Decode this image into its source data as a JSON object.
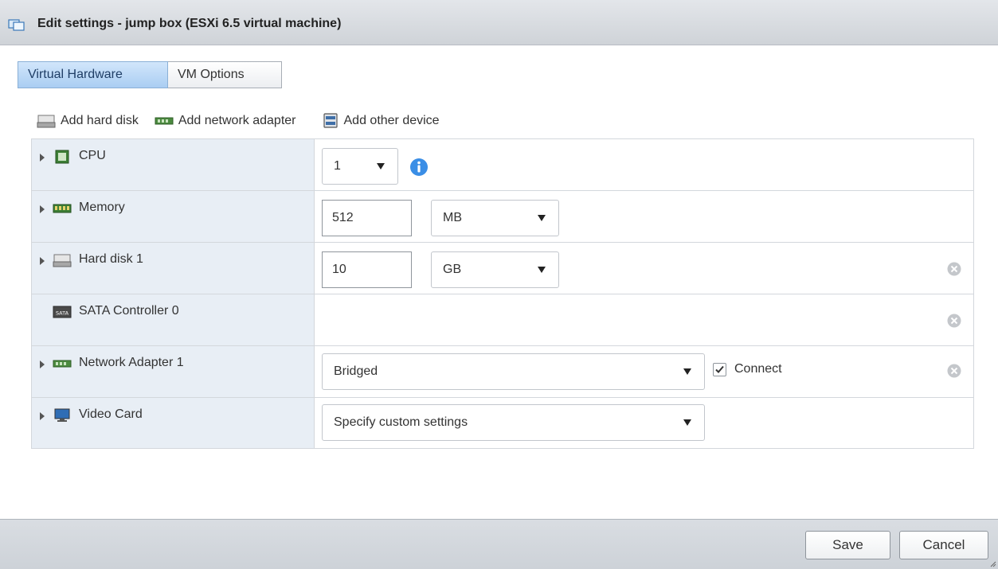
{
  "window": {
    "title": "Edit settings - jump box (ESXi 6.5 virtual machine)",
    "icon": "vm-icon"
  },
  "tabs": [
    {
      "label": "Virtual Hardware",
      "active": true
    },
    {
      "label": "VM Options",
      "active": false
    }
  ],
  "toolbar": {
    "add_hard_disk": "Add hard disk",
    "add_network_adapter": "Add network adapter",
    "add_other_device": "Add other device"
  },
  "devices": {
    "cpu": {
      "label": "CPU",
      "icon": "cpu-icon",
      "value": "1"
    },
    "memory": {
      "label": "Memory",
      "icon": "memory-icon",
      "value": "512",
      "unit": "MB"
    },
    "hard_disk": {
      "label": "Hard disk 1",
      "icon": "hard-disk-icon",
      "value": "10",
      "unit": "GB"
    },
    "sata": {
      "label": "SATA Controller 0",
      "icon": "sata-icon",
      "badge_text": "SATA"
    },
    "network": {
      "label": "Network Adapter 1",
      "icon": "network-adapter-icon",
      "value": "Bridged",
      "connect_label": "Connect",
      "connected": true
    },
    "video": {
      "label": "Video Card",
      "icon": "monitor-icon",
      "value": "Specify custom settings"
    }
  },
  "footer": {
    "save_label": "Save",
    "cancel_label": "Cancel"
  },
  "colors": {
    "tab_active": "#a9cdf2",
    "label_bg": "#e8eef5",
    "info": "#3a8ee6"
  }
}
